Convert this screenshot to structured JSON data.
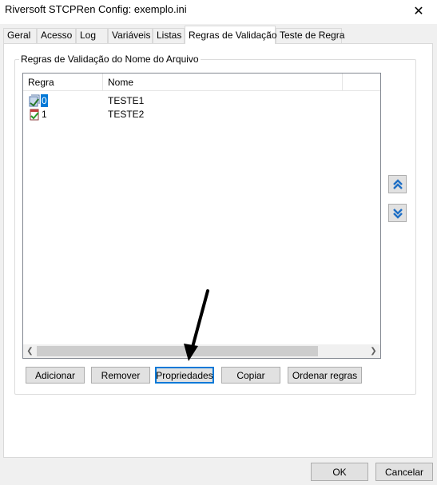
{
  "window": {
    "title": "Riversoft STCPRen Config: exemplo.ini",
    "close_glyph": "✕"
  },
  "tabs": [
    {
      "label": "Geral"
    },
    {
      "label": "Acesso"
    },
    {
      "label": "Log"
    },
    {
      "label": "Variáveis"
    },
    {
      "label": "Listas"
    },
    {
      "label": "Regras de Validação"
    },
    {
      "label": "Teste de Regra"
    }
  ],
  "active_tab": "Regras de Validação",
  "group": {
    "legend": "Regras de Validação do Nome do Arquivo"
  },
  "list": {
    "columns": [
      "Regra",
      "Nome"
    ],
    "rows": [
      {
        "regra": "0",
        "nome": "TESTE1",
        "selected": true,
        "icon": "rule-document-icon"
      },
      {
        "regra": "1",
        "nome": "TESTE2",
        "selected": false,
        "icon": "rule-checked-icon"
      }
    ]
  },
  "move_buttons": {
    "up_icon": "move-up-icon",
    "down_icon": "move-down-icon"
  },
  "actions": {
    "add": "Adicionar",
    "remove": "Remover",
    "properties": "Propriedades",
    "copy": "Copiar",
    "sort": "Ordenar regras"
  },
  "footer": {
    "ok": "OK",
    "cancel": "Cancelar"
  },
  "colors": {
    "selection": "#0078d7",
    "move_arrow": "#1f6fc5"
  }
}
